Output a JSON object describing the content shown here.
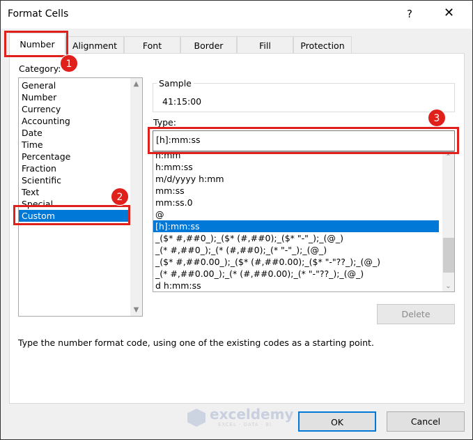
{
  "dialog": {
    "title": "Format Cells",
    "help_label": "?",
    "close_label": "✕"
  },
  "tabs": [
    {
      "label": "Number",
      "active": true
    },
    {
      "label": "Alignment"
    },
    {
      "label": "Font"
    },
    {
      "label": "Border"
    },
    {
      "label": "Fill"
    },
    {
      "label": "Protection"
    }
  ],
  "category": {
    "label": "Category:",
    "items": [
      "General",
      "Number",
      "Currency",
      "Accounting",
      "Date",
      "Time",
      "Percentage",
      "Fraction",
      "Scientific",
      "Text",
      "Special",
      "Custom"
    ],
    "selected": "Custom"
  },
  "sample": {
    "label": "Sample",
    "value": "41:15:00"
  },
  "type": {
    "label": "Type:",
    "value": "[h]:mm:ss",
    "items": [
      "h:mm",
      "h:mm:ss",
      "m/d/yyyy h:mm",
      "mm:ss",
      "mm:ss.0",
      "@",
      "[h]:mm:ss",
      "_($* #,##0_);_($* (#,##0);_($* \"-\"_);_(@_)",
      "_(* #,##0_);_(* (#,##0);_(* \"-\"_);_(@_)",
      "_($* #,##0.00_);_($* (#,##0.00);_($* \"-\"??_);_(@_)",
      "_(* #,##0.00_);_(* (#,##0.00);_(* \"-\"??_);_(@_)",
      "d h:mm:ss"
    ],
    "selected": "[h]:mm:ss"
  },
  "buttons": {
    "delete": "Delete",
    "ok": "OK",
    "cancel": "Cancel"
  },
  "hint": "Type the number format code, using one of the existing codes as a starting point.",
  "annotations": [
    "1",
    "2",
    "3"
  ],
  "watermark": {
    "name": "exceldemy",
    "tagline": "EXCEL · DATA · BI"
  },
  "colors": {
    "highlight": "#e0201b",
    "selection": "#0078d7"
  }
}
